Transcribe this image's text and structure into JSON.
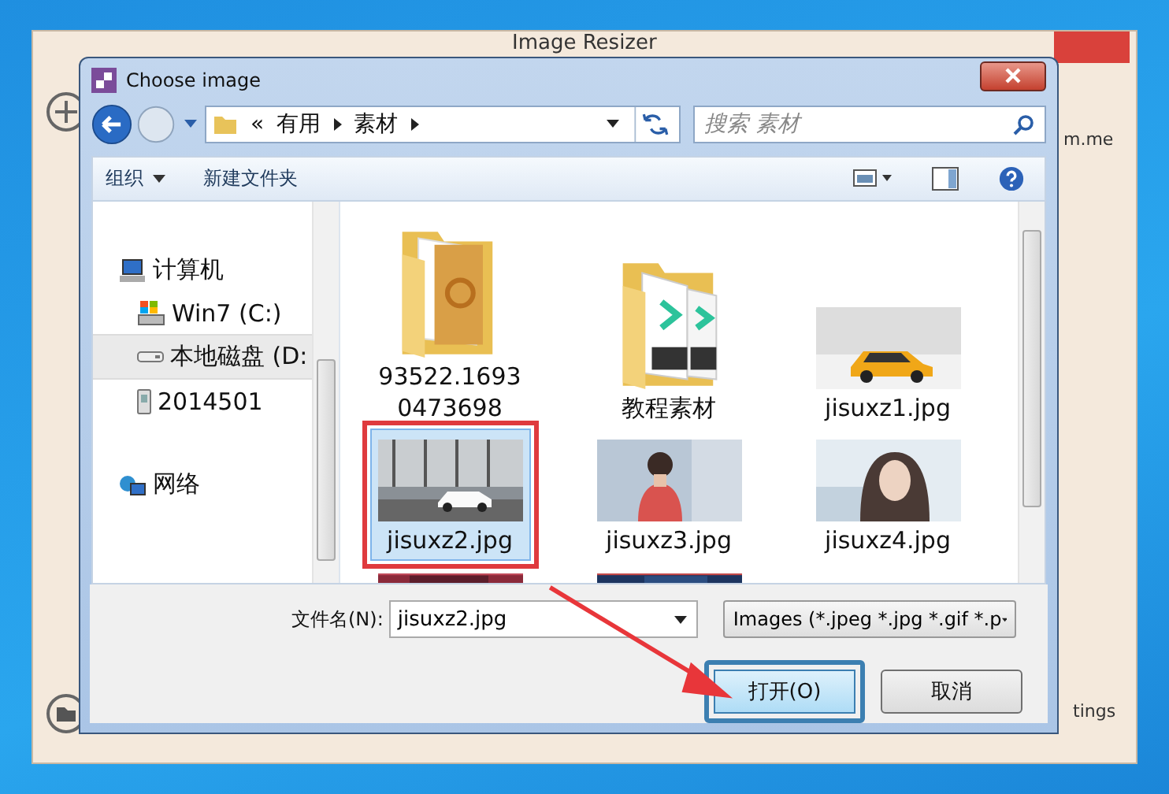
{
  "background_window": {
    "title": "Image Resizer",
    "text_right": "m.me",
    "text_bottom": "tings"
  },
  "dialog": {
    "title": "Choose image",
    "breadcrumb": [
      "«",
      "有用",
      "素材"
    ],
    "search": {
      "placeholder": "搜索 素材"
    },
    "toolbar": [
      {
        "label": "组织",
        "dropdown": true
      },
      {
        "label": "新建文件夹",
        "dropdown": false
      }
    ],
    "nav_tree": [
      {
        "label": "计算机",
        "selected": false,
        "children": [
          {
            "label": "Win7 (C:)",
            "selected": false
          },
          {
            "label": "本地磁盘 (D:",
            "selected": true
          },
          {
            "label": "2014501",
            "selected": false
          }
        ]
      },
      {
        "label": "网络",
        "selected": false
      }
    ],
    "files": [
      {
        "kind": "folder",
        "lines": [
          "93522.1693",
          "0473698"
        ],
        "selected": false,
        "highlighted": false
      },
      {
        "kind": "folder",
        "lines": [
          "教程素材"
        ],
        "selected": false,
        "highlighted": false
      },
      {
        "kind": "picture",
        "lines": [
          "jisuxz1.jpg"
        ],
        "selected": false,
        "highlighted": false
      },
      {
        "kind": "picture",
        "lines": [
          "jisuxz2.jpg"
        ],
        "selected": true,
        "highlighted": true
      },
      {
        "kind": "picture",
        "lines": [
          "jisuxz3.jpg"
        ],
        "selected": false,
        "highlighted": false
      },
      {
        "kind": "picture",
        "lines": [
          "jisuxz4.jpg"
        ],
        "selected": false,
        "highlighted": false
      },
      {
        "kind": "picture"
      },
      {
        "kind": "picture"
      }
    ],
    "file_name": {
      "label": "文件名(N):",
      "value": "jisuxz2.jpg"
    },
    "file_type": {
      "value": "Images (*.jpeg *.jpg *.gif *.p"
    },
    "buttons": [
      {
        "label": "打开(O)",
        "default": true,
        "highlighted": true
      },
      {
        "label": "取消",
        "default": false,
        "highlighted": false
      }
    ],
    "callout_arrow": true
  }
}
